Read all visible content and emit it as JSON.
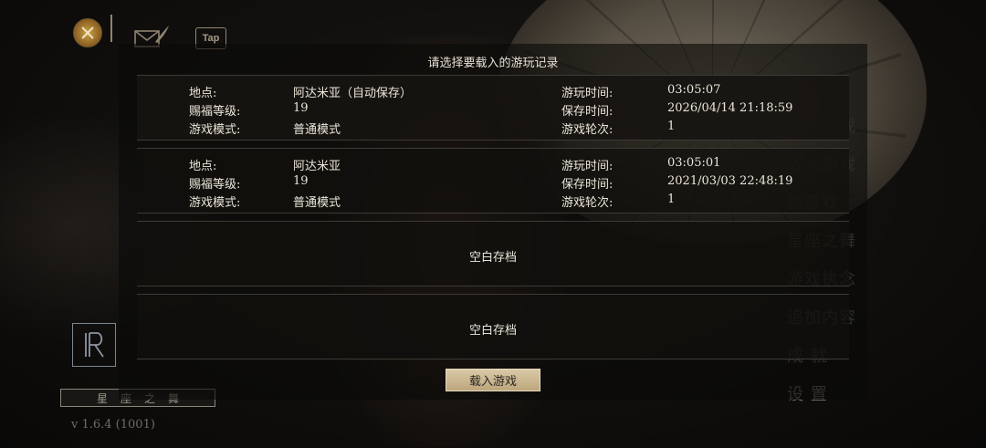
{
  "top_bar": {
    "close_icon": "close-icon",
    "mail_icon": "mail-feather-icon",
    "tap_label": "Tap"
  },
  "side_menu": {
    "items": [
      "继续游戏",
      "载入游戏",
      "新游戏",
      "星座之舞",
      "游戏执念",
      "追加内容",
      "成 就",
      "设 置"
    ]
  },
  "branding": {
    "game_title": "星座之舞",
    "version": "v 1.6.4 (1001)"
  },
  "dialog": {
    "title": "请选择要载入的游玩记录",
    "slots": [
      {
        "location_label": "地点:",
        "location": "阿达米亚（自动保存）",
        "level_label": "赐福等级:",
        "level": "19",
        "mode_label": "游戏模式:",
        "mode": "普通模式",
        "playtime_label": "游玩时间:",
        "playtime": "03:05:07",
        "savetime_label": "保存时间:",
        "savetime": "2026/04/14 21:18:59",
        "round_label": "游戏轮次:",
        "round": "1"
      },
      {
        "location_label": "地点:",
        "location": "阿达米亚",
        "level_label": "赐福等级:",
        "level": "19",
        "mode_label": "游戏模式:",
        "mode": "普通模式",
        "playtime_label": "游玩时间:",
        "playtime": "03:05:01",
        "savetime_label": "保存时间:",
        "savetime": "2021/03/03 22:48:19",
        "round_label": "游戏轮次:",
        "round": "1"
      }
    ],
    "empty_slots": [
      "空白存档",
      "空白存档"
    ],
    "load_button": "载入游戏"
  },
  "colors": {
    "accent_gold": "#c9a24a",
    "button_bg": "#d9c9a6"
  }
}
